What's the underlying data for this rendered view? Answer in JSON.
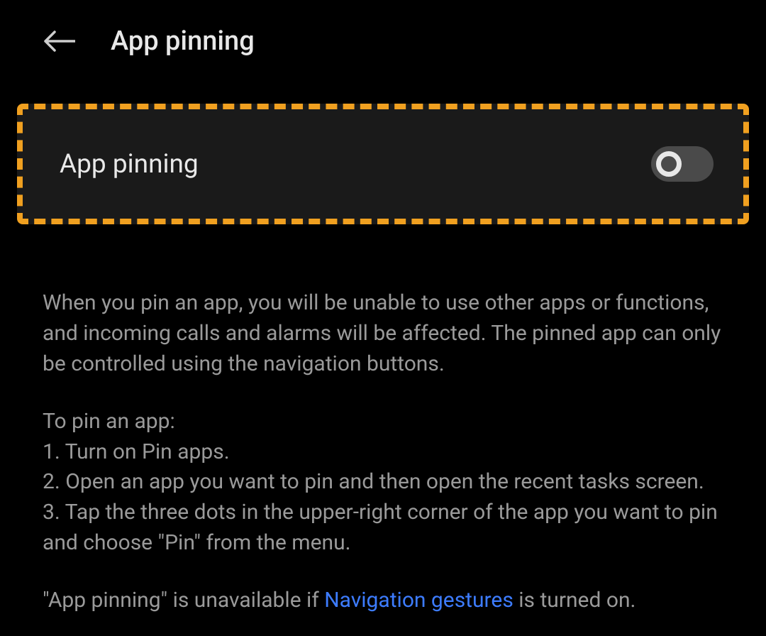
{
  "header": {
    "title": "App pinning"
  },
  "toggle_row": {
    "label": "App pinning",
    "enabled": false
  },
  "description": {
    "intro": "When you pin an app, you will be unable to use other apps or functions, and incoming calls and alarms will be affected. The pinned app can only be controlled using the navigation buttons.",
    "heading": "To pin an app:",
    "steps": [
      "1. Turn on Pin apps.",
      "2. Open an app you want to pin and then open the recent tasks screen.",
      "3. Tap the three dots in the upper-right corner of the app you want to pin and choose \"Pin\" from the menu."
    ],
    "availability_prefix": "\"App pinning\" is unavailable if ",
    "availability_link": "Navigation gestures",
    "availability_suffix": " is turned on."
  }
}
